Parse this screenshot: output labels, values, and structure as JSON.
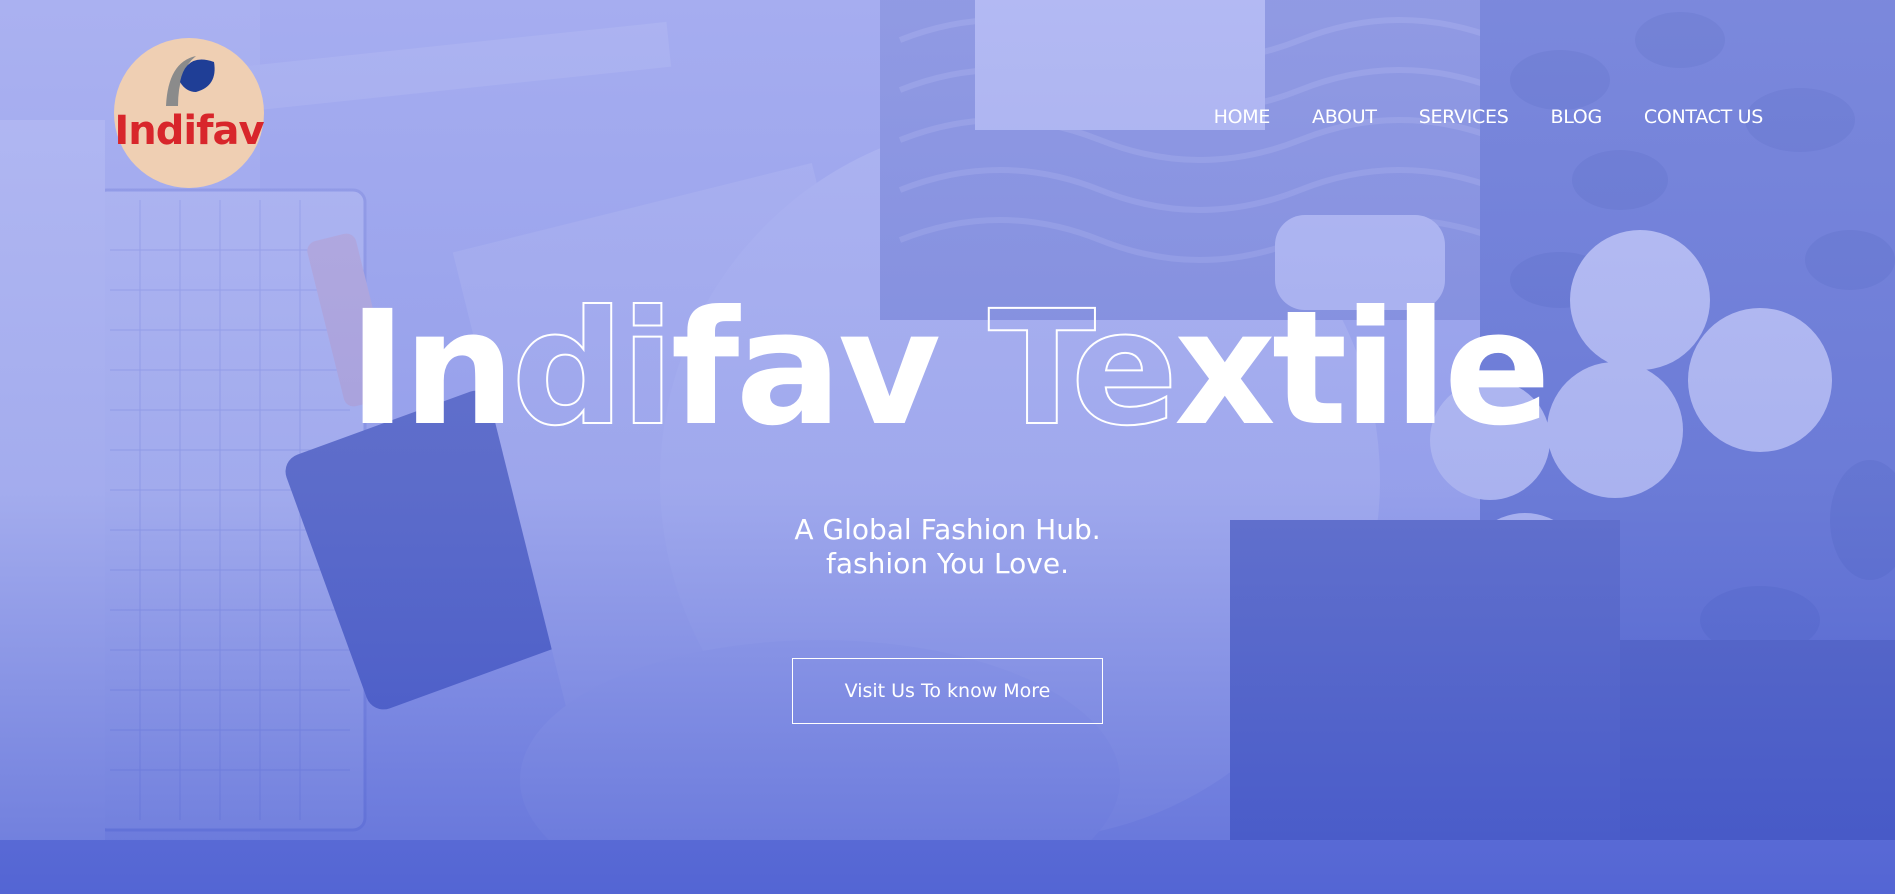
{
  "logo": {
    "text": "Indifav"
  },
  "nav": {
    "items": [
      {
        "label": "HOME"
      },
      {
        "label": "ABOUT"
      },
      {
        "label": "SERVICES"
      },
      {
        "label": "BLOG"
      },
      {
        "label": "CONTACT US"
      }
    ]
  },
  "hero": {
    "title_parts": [
      {
        "text": "In",
        "style": "solid"
      },
      {
        "text": "di",
        "style": "outline"
      },
      {
        "text": "fav ",
        "style": "solid"
      },
      {
        "text": "Te",
        "style": "outline"
      },
      {
        "text": "xtile",
        "style": "solid"
      }
    ],
    "subtitle_line1": "A Global Fashion Hub.",
    "subtitle_line2": "fashion You Love.",
    "cta_label": "Visit Us To know More"
  },
  "colors": {
    "logo_bg": "#efcfb3",
    "logo_text": "#d8262b",
    "overlay": "#6f7fe0",
    "text": "#ffffff"
  }
}
